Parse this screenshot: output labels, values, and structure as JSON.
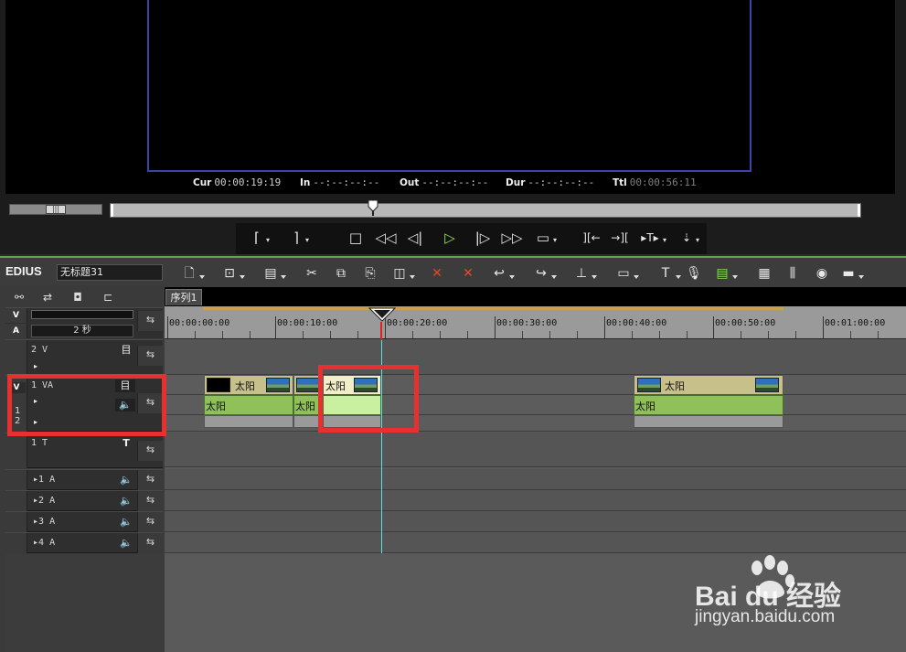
{
  "player": {
    "cur_label": "Cur",
    "cur_value": "00:00:19:19",
    "in_label": "In",
    "in_value": "--:--:--:--",
    "out_label": "Out",
    "out_value": "--:--:--:--",
    "dur_label": "Dur",
    "dur_value": "--:--:--:--",
    "ttl_label": "Ttl",
    "ttl_value": "00:00:56:11"
  },
  "app": {
    "name": "EDIUS",
    "project": "无标题31"
  },
  "sequence_tab": "序列1",
  "zoom_label": "2 秒",
  "side_labels": {
    "v": "V",
    "a": "A",
    "one": "1",
    "two": "2"
  },
  "ruler": [
    "00:00:00:00",
    "00:00:10:00",
    "00:00:20:00",
    "00:00:30:00",
    "00:00:40:00",
    "00:00:50:00",
    "00:01:00:00"
  ],
  "tracks": {
    "t2v": "2 V",
    "t1va": "1 VA",
    "t1t": "1 T",
    "a1": "1 A",
    "a2": "2 A",
    "a3": "3 A",
    "a4": "4 A"
  },
  "clips": {
    "c1_v": "太阳",
    "c1_a": "太阳",
    "c2_a": "太阳",
    "c3_v": "太阳",
    "c4_v": "太阳",
    "c4_a": "太阳"
  },
  "watermark": {
    "main": "Bai du 经验",
    "sub": "jingyan.baidu.com"
  },
  "colors": {
    "accent_green": "#5da84a",
    "highlight_red": "#e83030",
    "cursor": "#5fe0e0"
  }
}
